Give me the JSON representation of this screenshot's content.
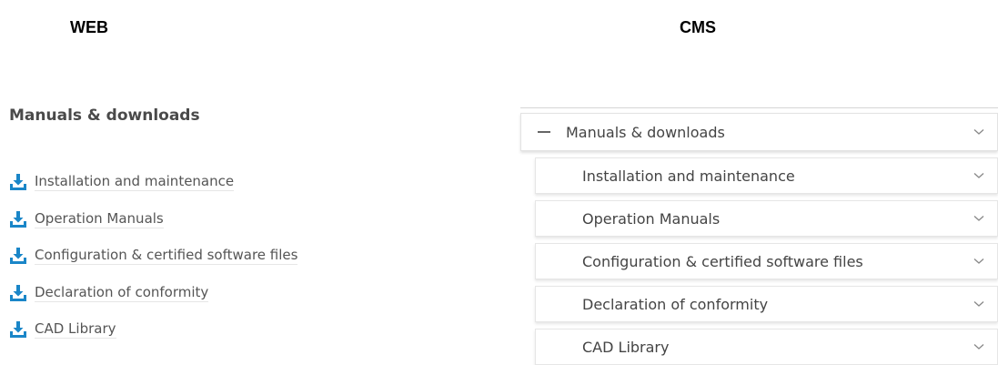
{
  "headings": {
    "web": "WEB",
    "cms": "CMS"
  },
  "web": {
    "title": "Manuals & downloads",
    "items": [
      {
        "label": "Installation and maintenance",
        "icon": "download-icon"
      },
      {
        "label": "Operation Manuals",
        "icon": "download-icon"
      },
      {
        "label": "Configuration & certified software files",
        "icon": "download-icon"
      },
      {
        "label": "Declaration of conformity",
        "icon": "download-icon"
      },
      {
        "label": "CAD Library",
        "icon": "download-icon"
      }
    ]
  },
  "cms": {
    "main": {
      "label": "Manuals & downloads",
      "expanded": true
    },
    "items": [
      {
        "label": "Installation and maintenance"
      },
      {
        "label": "Operation Manuals"
      },
      {
        "label": "Configuration & certified software files"
      },
      {
        "label": "Declaration of conformity"
      },
      {
        "label": "CAD Library"
      }
    ]
  },
  "colors": {
    "icon_blue": "#1a86c8",
    "text": "#555555",
    "heading": "#000000"
  }
}
